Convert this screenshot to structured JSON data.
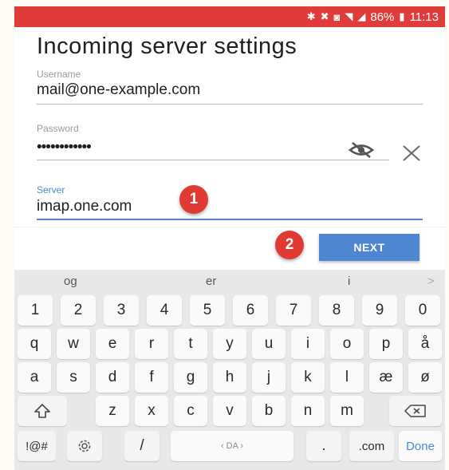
{
  "status_bar": {
    "icons": [
      "bluetooth-icon",
      "mute-icon",
      "alarm-icon",
      "wifi-icon",
      "signal-icon",
      "battery-icon"
    ],
    "battery": "86%",
    "time": "11:13"
  },
  "screen": {
    "title": "Incoming server settings",
    "username": {
      "label": "Username",
      "value": "mail@one-example.com"
    },
    "password": {
      "label": "Password",
      "value": "••••••••••••"
    },
    "server": {
      "label": "Server",
      "value": "imap.one.com"
    },
    "next_label": "NEXT"
  },
  "annotations": {
    "step1": "1",
    "step2": "2"
  },
  "keyboard": {
    "suggestions": [
      "og",
      "er",
      "i",
      ">"
    ],
    "row_numbers": [
      "1",
      "2",
      "3",
      "4",
      "5",
      "6",
      "7",
      "8",
      "9",
      "0"
    ],
    "row1": [
      "q",
      "w",
      "e",
      "r",
      "t",
      "y",
      "u",
      "i",
      "o",
      "p",
      "å"
    ],
    "row2": [
      "a",
      "s",
      "d",
      "f",
      "g",
      "h",
      "j",
      "k",
      "l",
      "æ",
      "ø"
    ],
    "row3": [
      "z",
      "x",
      "c",
      "v",
      "b",
      "n",
      "m"
    ],
    "symbols_label": "!@#",
    "slash_label": "/",
    "space_label": "‹ DA ›",
    "period_label": ".",
    "com_label": ".com",
    "done_label": "Done"
  },
  "colors": {
    "accent": "#4f86d2",
    "annotation": "#e03a32",
    "status_bar": "#e03c3c"
  }
}
